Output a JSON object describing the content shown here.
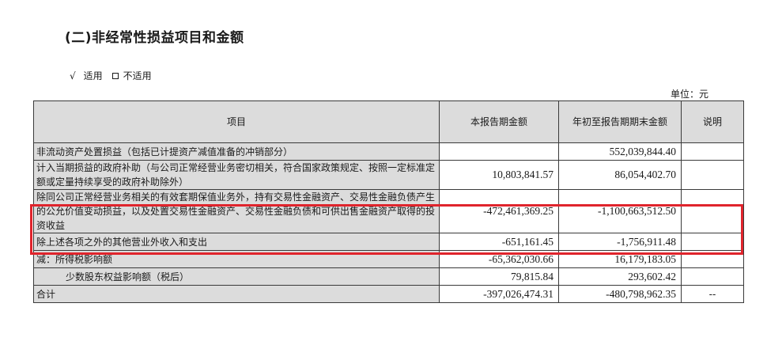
{
  "section": {
    "title": "(二)非经常性损益项目和金额"
  },
  "applicability": {
    "applies_mark": "√",
    "applies_label": "适用",
    "not_applies_label": "不适用"
  },
  "unit": "单位：元",
  "table": {
    "headers": {
      "item": "项目",
      "current": "本报告期金额",
      "ytd": "年初至报告期期末金额",
      "note": "说明"
    },
    "rows": [
      {
        "item": "非流动资产处置损益（包括已计提资产减值准备的冲销部分）",
        "current": "",
        "ytd": "552,039,844.40",
        "note": ""
      },
      {
        "item": "计入当期损益的政府补助（与公司正常经营业务密切相关，符合国家政策规定、按照一定标准定额或定量持续享受的政府补助除外）",
        "current": "10,803,841.57",
        "ytd": "86,054,402.70",
        "note": ""
      },
      {
        "item": "除同公司正常经营业务相关的有效套期保值业务外，持有交易性金融资产、交易性金融负债产生的公允价值变动损益，以及处置交易性金融资产、交易性金融负债和可供出售金融资产取得的投资收益",
        "current": "-472,461,369.25",
        "ytd": "-1,100,663,512.50",
        "note": ""
      },
      {
        "item": "除上述各项之外的其他营业外收入和支出",
        "current": "-651,161.45",
        "ytd": "-1,756,911.48",
        "note": ""
      },
      {
        "item": "减：所得税影响额",
        "current": "-65,362,030.66",
        "ytd": "16,179,183.05",
        "note": ""
      },
      {
        "item": "少数股东权益影响额（税后）",
        "current": "79,815.84",
        "ytd": "293,602.42",
        "note": ""
      },
      {
        "item": "合计",
        "current": "-397,026,474.31",
        "ytd": "-480,798,962.35",
        "note": "--"
      }
    ]
  },
  "colors": {
    "highlight_border": "#e0242c",
    "header_bg": "#dcdcdc",
    "item_bg": "#dcdcdc"
  }
}
